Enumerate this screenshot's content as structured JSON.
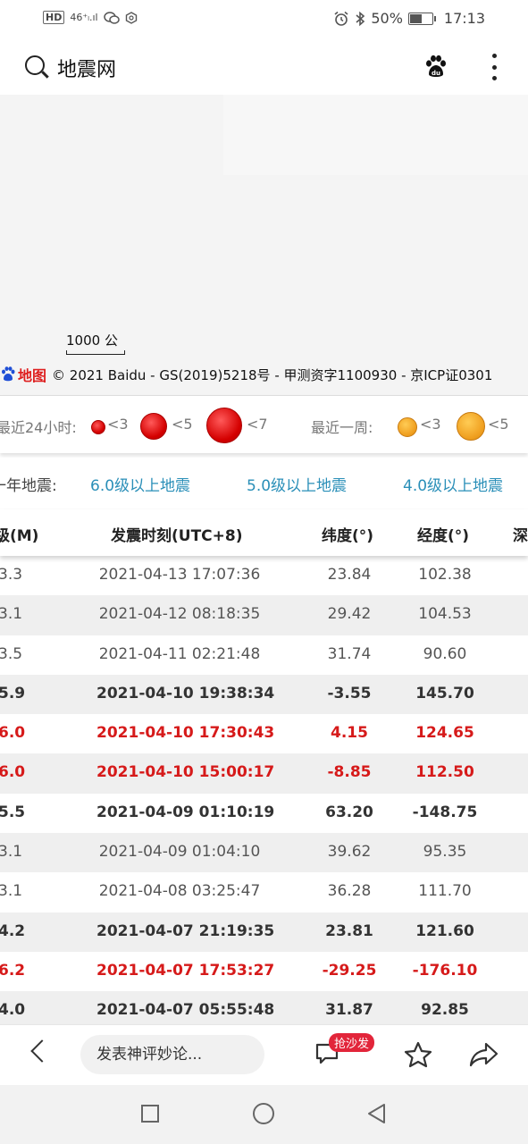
{
  "status": {
    "left_hd": "HD",
    "left_signal": "46⁺ₗ.ıl",
    "battery": "50%",
    "battery_level": 0.5,
    "time": "17:13"
  },
  "header": {
    "title": "地震网"
  },
  "map": {
    "scale_label": "1000 公",
    "logo_text": "地图",
    "copyright": "© 2021 Baidu - GS(2019)5218号 - 甲测资字1100930 - 京ICP证0301"
  },
  "legend": {
    "recent24": "最近24小时:",
    "lt3": "<3",
    "lt5": "<5",
    "lt7": "<7",
    "recentWeek": "最近一周:",
    "w_lt3": "<3",
    "w_lt5": "<5"
  },
  "filters": {
    "label": "一年地震:",
    "m6": "6.0级以上地震",
    "m5": "5.0级以上地震",
    "m4": "4.0级以上地震"
  },
  "table": {
    "headers": {
      "mag": "级(M)",
      "time": "发震时刻(UTC+8)",
      "lat": "纬度(°)",
      "lon": "经度(°)",
      "depth": "深"
    },
    "rows": [
      {
        "mag": "3.3",
        "time": "2021-04-13 17:07:36",
        "lat": "23.84",
        "lon": "102.38"
      },
      {
        "mag": "3.1",
        "time": "2021-04-12 08:18:35",
        "lat": "29.42",
        "lon": "104.53"
      },
      {
        "mag": "3.5",
        "time": "2021-04-11 02:21:48",
        "lat": "31.74",
        "lon": "90.60"
      },
      {
        "mag": "5.9",
        "time": "2021-04-10 19:38:34",
        "lat": "-3.55",
        "lon": "145.70"
      },
      {
        "mag": "6.0",
        "time": "2021-04-10 17:30:43",
        "lat": "4.15",
        "lon": "124.65"
      },
      {
        "mag": "6.0",
        "time": "2021-04-10 15:00:17",
        "lat": "-8.85",
        "lon": "112.50"
      },
      {
        "mag": "5.5",
        "time": "2021-04-09 01:10:19",
        "lat": "63.20",
        "lon": "-148.75"
      },
      {
        "mag": "3.1",
        "time": "2021-04-09 01:04:10",
        "lat": "39.62",
        "lon": "95.35"
      },
      {
        "mag": "3.1",
        "time": "2021-04-08 03:25:47",
        "lat": "36.28",
        "lon": "111.70"
      },
      {
        "mag": "4.2",
        "time": "2021-04-07 21:19:35",
        "lat": "23.81",
        "lon": "121.60"
      },
      {
        "mag": "6.2",
        "time": "2021-04-07 17:53:27",
        "lat": "-29.25",
        "lon": "-176.10"
      },
      {
        "mag": "4.0",
        "time": "2021-04-07 05:55:48",
        "lat": "31.87",
        "lon": "92.85"
      }
    ]
  },
  "comment": {
    "placeholder": "发表神评妙论...",
    "badge": "抢沙发"
  },
  "colors": {
    "link": "#2a8fb8",
    "highlight_red": "#d61a1a",
    "badge_red": "#e2253a",
    "baidu_red": "#de1f1f"
  }
}
